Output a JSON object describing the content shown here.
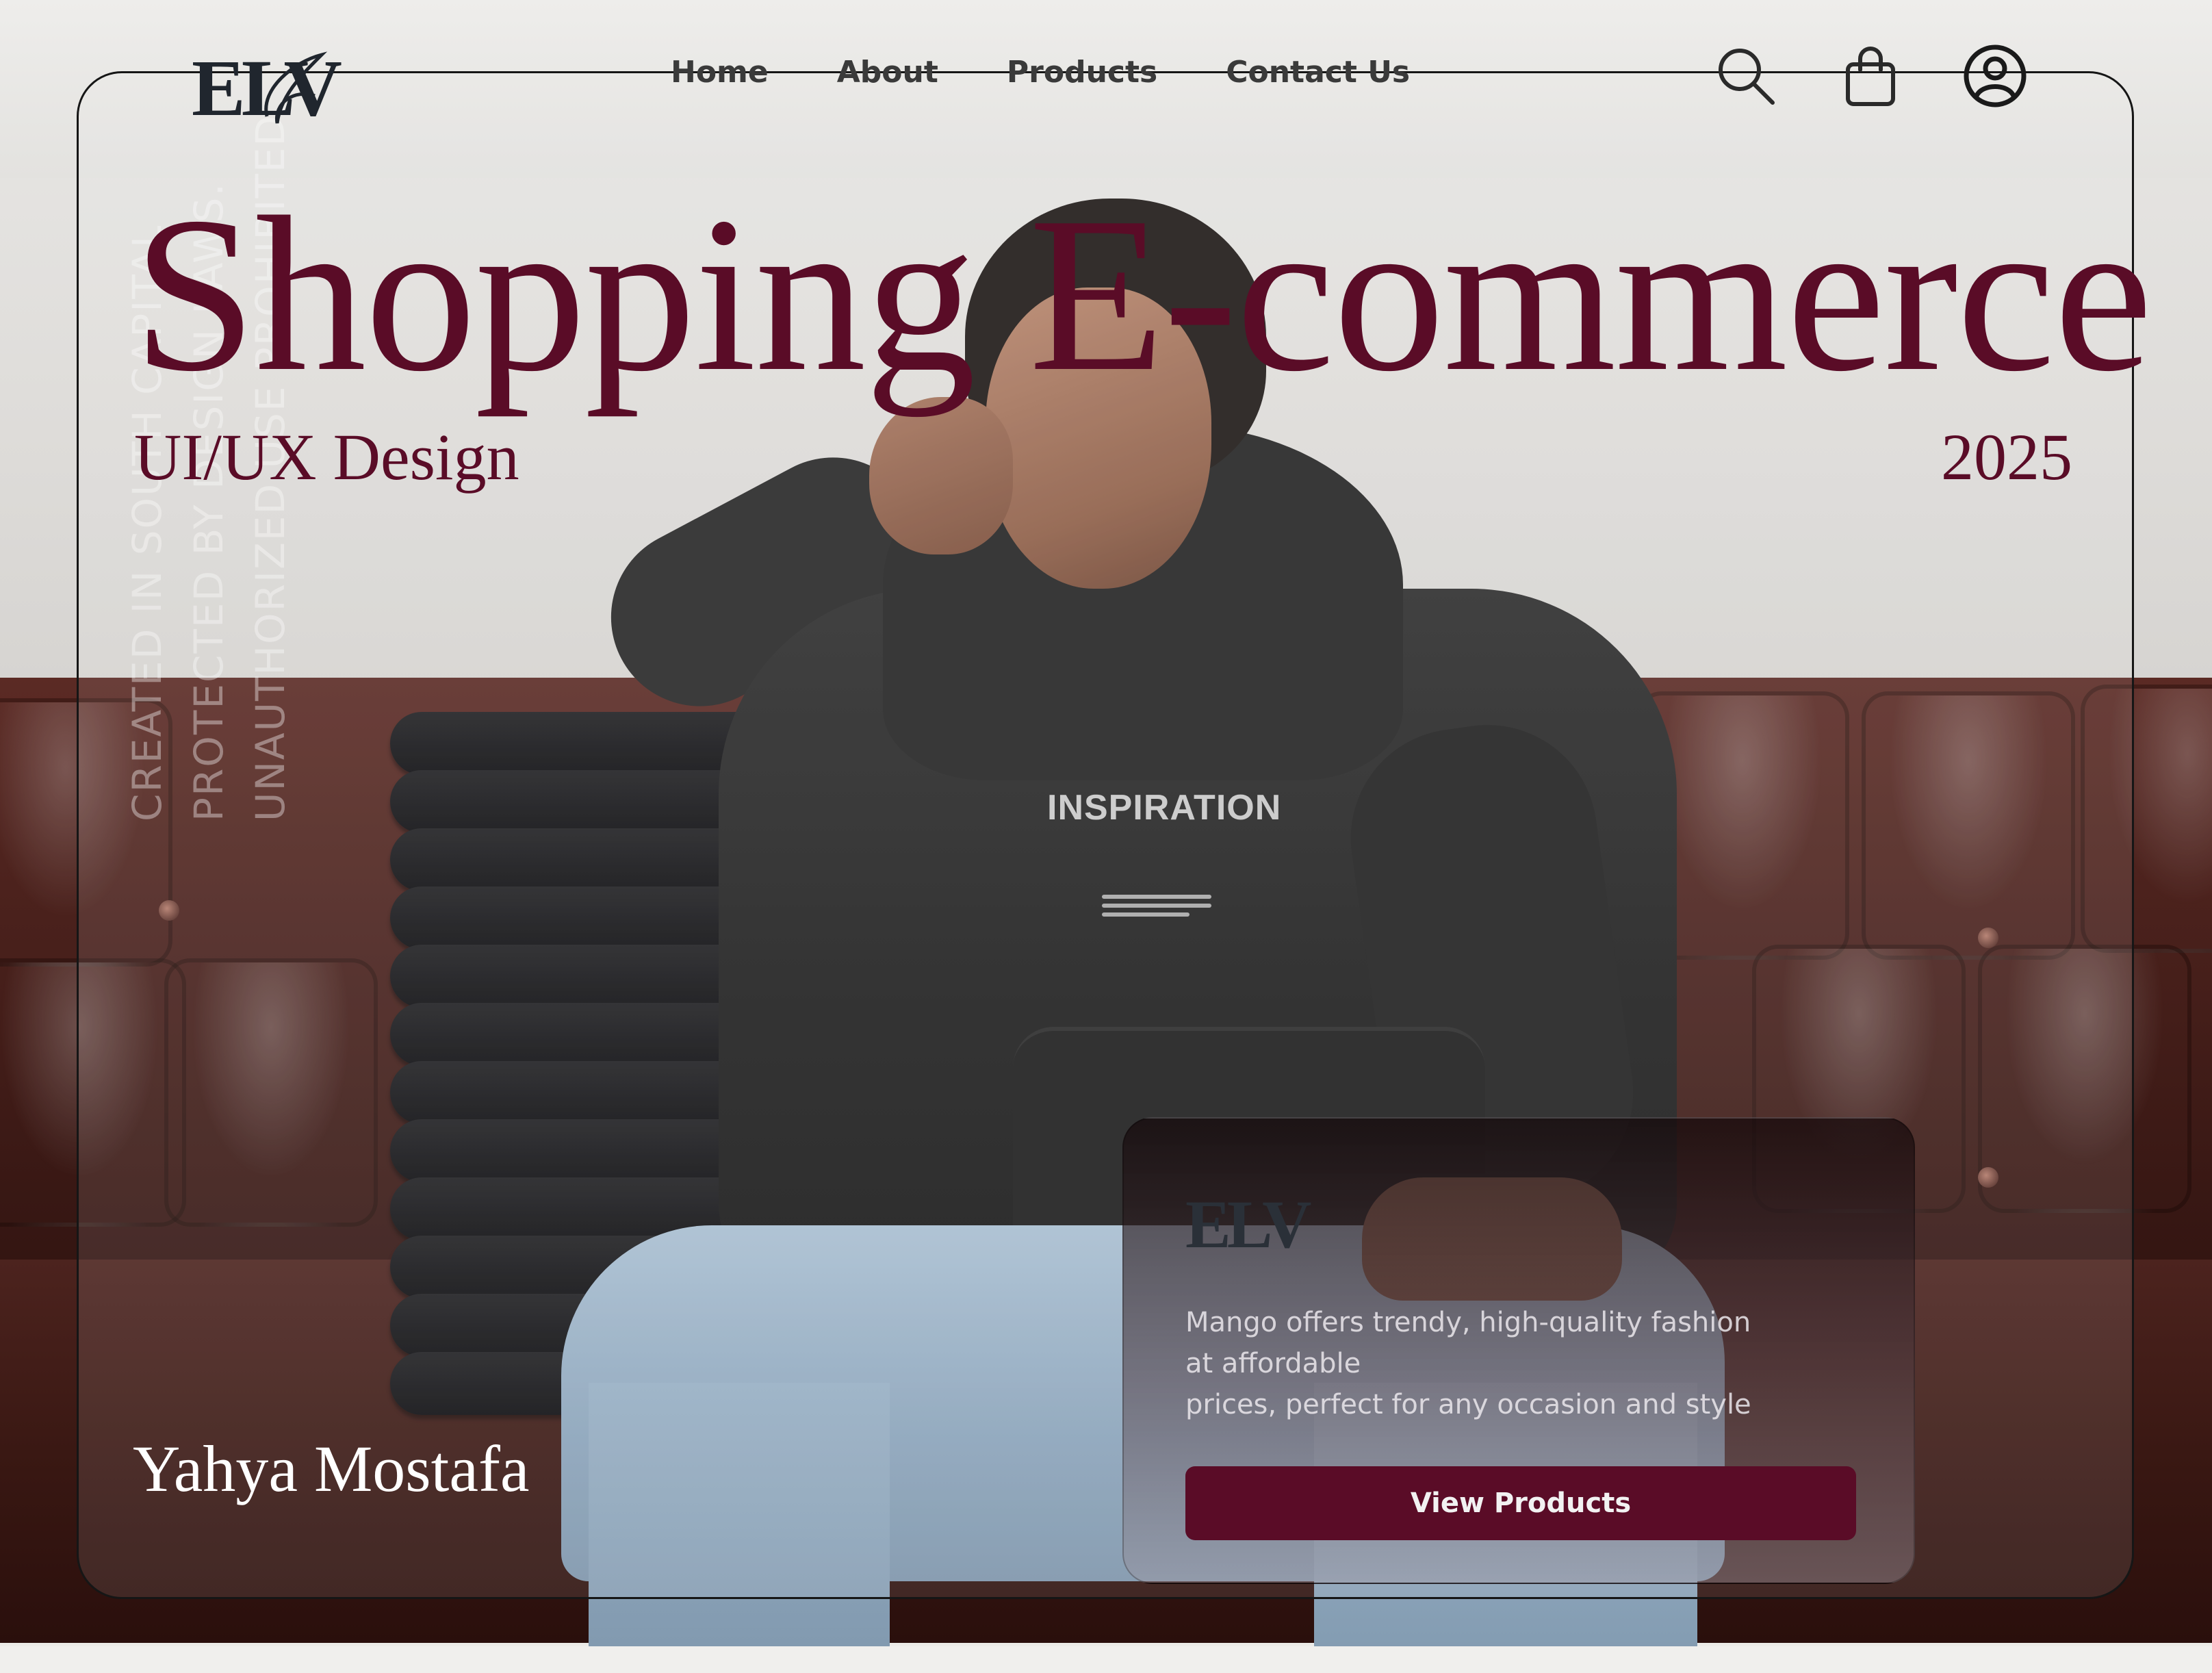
{
  "brand": {
    "logo_text": "ELV"
  },
  "nav": {
    "items": [
      "Home",
      "About",
      "Products",
      "Contact Us"
    ]
  },
  "header_icons": [
    "search-icon",
    "shopping-bag-icon",
    "user-account-icon"
  ],
  "hero": {
    "title": "Shopping E-commerce",
    "subtitle": "UI/UX Design",
    "year": "2025",
    "author": "Yahya Mostafa"
  },
  "watermark": {
    "lines": [
      "CREATED IN SOUTH CAPITAL",
      "PROTECTED BY DESIGN LAWS.",
      "UNAUTHORIZED USE PROHIBITED."
    ]
  },
  "shirt_print": {
    "text": "INSPIRATION"
  },
  "card": {
    "logo_text": "ELV",
    "description_lines": [
      "Mango  offers trendy, high-quality fashion",
      "at affordable",
      "prices, perfect for any occasion and style"
    ],
    "button_label": "View Products"
  },
  "colors": {
    "accent": "#5a0c27",
    "text_dark": "#20262e",
    "frame_border": "#161616"
  }
}
